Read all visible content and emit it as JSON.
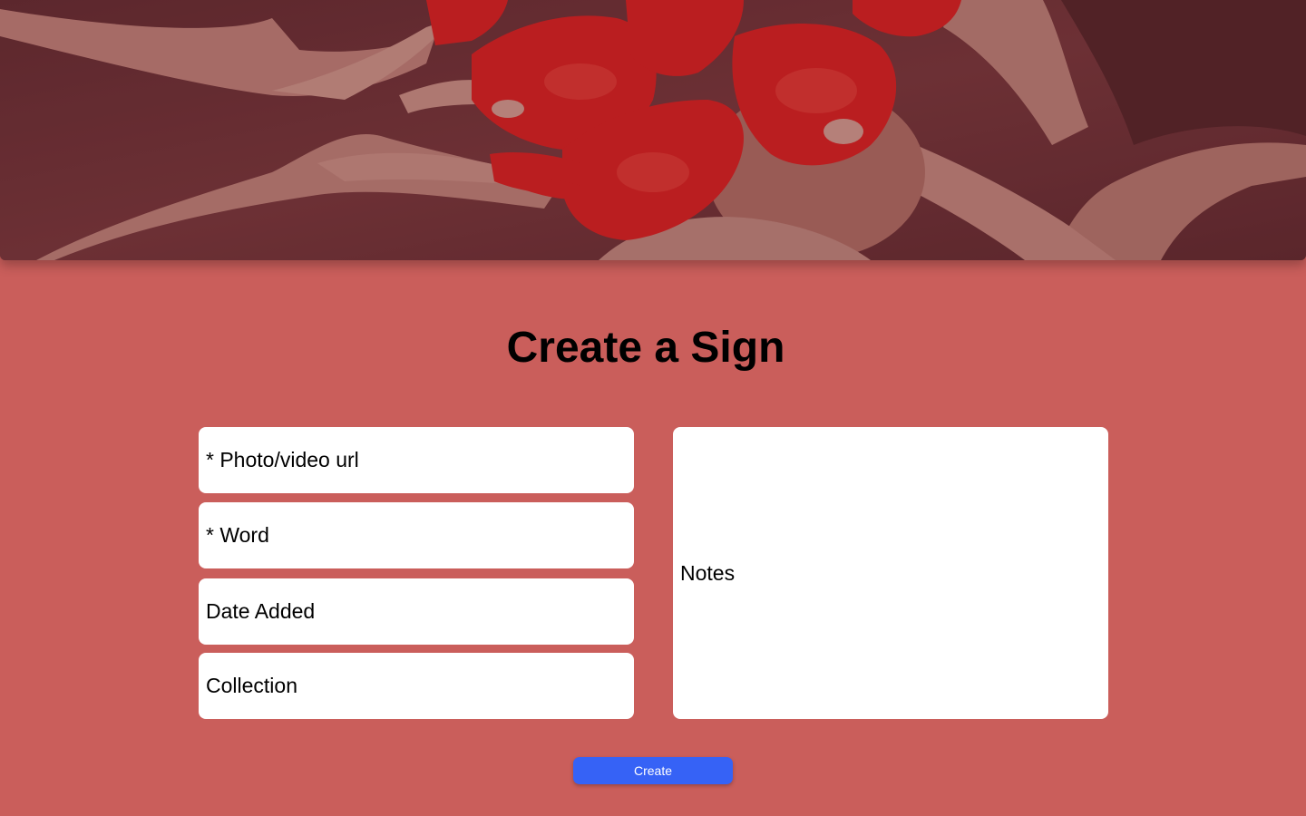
{
  "header": {
    "banner_image": "painted-hands-photo"
  },
  "title": "Create a Sign",
  "form": {
    "photo_url_placeholder": "* Photo/video url",
    "word_placeholder": "* Word",
    "date_added_placeholder": "Date Added",
    "collection_placeholder": "Collection",
    "notes_placeholder": "Notes",
    "submit_label": "Create"
  },
  "colors": {
    "page_background": "#ca5e5b",
    "banner_tint": "#6a3337",
    "paint_red": "#e01f1f",
    "button": "#3662f6"
  }
}
